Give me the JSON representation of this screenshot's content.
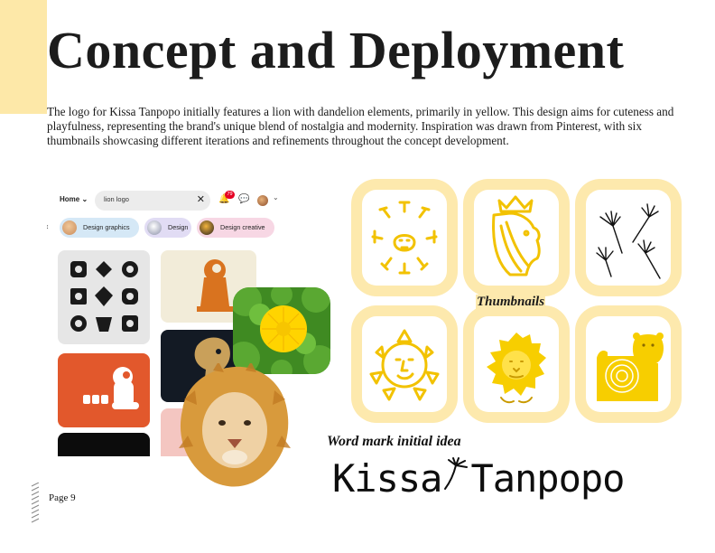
{
  "document": {
    "title": "Concept and Deployment",
    "intro": "The logo for Kissa Tanpopo initially features a lion with dandelion elements, primarily in yellow. This design aims for cuteness and playfulness, representing the brand's unique blend of nostalgia and modernity. Inspiration was drawn from Pinterest, with six thumbnails showcasing different iterations and refinements throughout the concept development.",
    "page_label": "Page 9",
    "accent_color": "#fde8a8"
  },
  "pinterest": {
    "home_label": "Home",
    "search_value": "lion logo",
    "notification_count": "79",
    "chips": [
      {
        "label": "Design graphics"
      },
      {
        "label": "Design"
      },
      {
        "label": "Design creative"
      }
    ],
    "icons": [
      "chevron-down-icon",
      "close-icon",
      "bell-icon",
      "chat-icon",
      "avatar",
      "chevron-left-icon"
    ]
  },
  "thumbnails": {
    "label": "Thumbnails",
    "frame_color": "#fde9ad",
    "sketch_color": "#f2c200",
    "items": [
      {
        "name": "lion-face-with-rays"
      },
      {
        "name": "lion-profile-with-crown"
      },
      {
        "name": "dandelion-seeds"
      },
      {
        "name": "sun-face"
      },
      {
        "name": "fluffy-lion-head"
      },
      {
        "name": "lion-body"
      }
    ]
  },
  "wordmark": {
    "caption": "Word mark initial idea",
    "left": "Kissa",
    "right": "Tanpopo"
  }
}
